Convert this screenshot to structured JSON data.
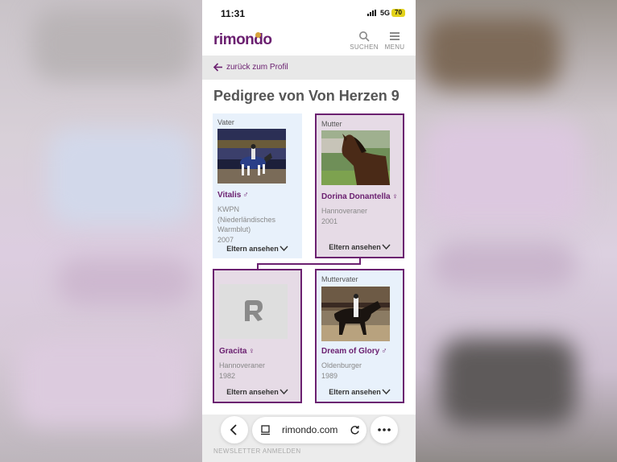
{
  "status": {
    "time": "11:31",
    "network": "5G",
    "battery": "70"
  },
  "header": {
    "logo": "rimondo",
    "search_label": "SUCHEN",
    "menu_label": "MENU"
  },
  "nav": {
    "back_label": "zurück zum Profil"
  },
  "page": {
    "title": "Pedigree von Von Herzen 9"
  },
  "pedigree": [
    {
      "role": "Vater",
      "name": "Vitalis",
      "sex": "♂",
      "breed": "KWPN (Niederländisches Warmblut)",
      "year": "2007",
      "link": "Eltern ansehen"
    },
    {
      "role": "Mutter",
      "name": "Dorina Donantella",
      "sex": "♀",
      "breed": "Hannoveraner",
      "year": "2001",
      "link": "Eltern ansehen"
    },
    {
      "role": "",
      "name": "Gracita",
      "sex": "♀",
      "breed": "Hannoveraner",
      "year": "1982",
      "link": "Eltern ansehen"
    },
    {
      "role": "Muttervater",
      "name": "Dream of Glory",
      "sex": "♂",
      "breed": "Oldenburger",
      "year": "1989",
      "link": "Eltern ansehen"
    }
  ],
  "footer": {
    "newsletter": "NEWSLETTER ANMELDEN"
  },
  "browser": {
    "url": "rimondo.com"
  },
  "colors": {
    "brand_purple": "#6b2070",
    "card_blue": "#e8f1fb",
    "card_purple": "#e6dbe6"
  }
}
